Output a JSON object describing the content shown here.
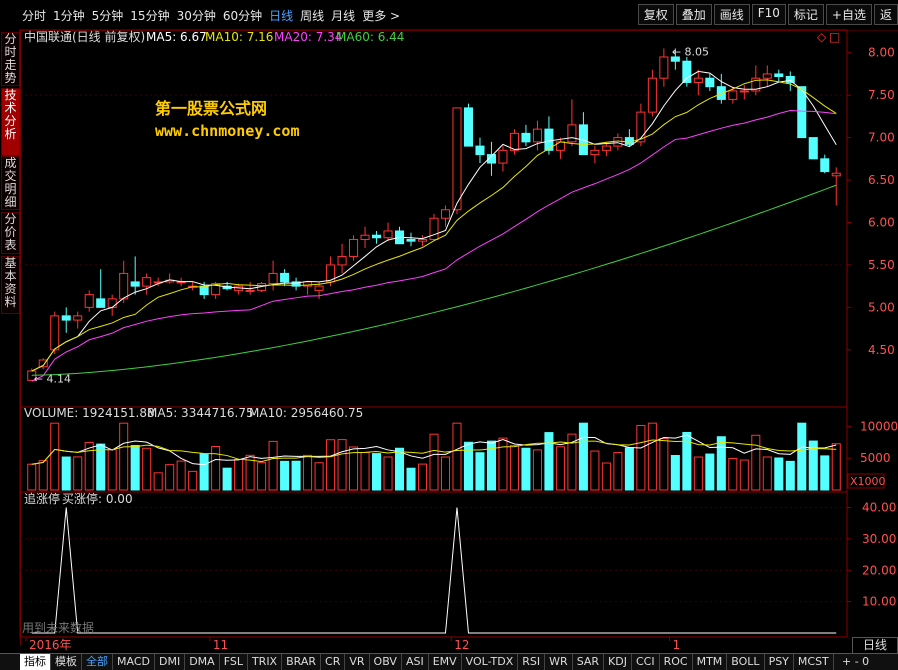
{
  "periods": [
    "分时",
    "1分钟",
    "5分钟",
    "15分钟",
    "30分钟",
    "60分钟",
    "日线",
    "周线",
    "月线",
    "更多 >"
  ],
  "active_period": "日线",
  "tools": [
    "复权",
    "叠加",
    "画线",
    "F10",
    "标记",
    "+自选",
    "返"
  ],
  "left_tabs": [
    "分时走势",
    "技术分析",
    "成交明细",
    "分价表",
    "基本资料"
  ],
  "active_left_tab": "技术分析",
  "main": {
    "stock": "中国联通(日线 前复权)",
    "ma5": "MA5: 6.67",
    "ma10": "MA10: 7.16",
    "ma20": "MA20: 7.34",
    "ma60": "MA60: 6.44",
    "yticks": [
      "8.00",
      "7.50",
      "7.00",
      "6.50",
      "6.00",
      "5.50",
      "5.00",
      "4.50"
    ],
    "high_label": "8.05",
    "low_label": "4.14",
    "colors": {
      "up": "#ff3333",
      "down": "#54ffff",
      "ma5": "#ffffff",
      "ma10": "#e6e600",
      "ma20": "#ff40ff",
      "ma60": "#40d040"
    }
  },
  "watermark": {
    "line1": "第一股票公式网",
    "line2": "www.chnmoney.com"
  },
  "volume": {
    "label": "VOLUME: 1924151.88",
    "ma5": "MA5: 3344716.75",
    "ma10": "MA10: 2956460.75",
    "yticks": [
      "10000",
      "5000"
    ],
    "unit": "X1000"
  },
  "indicator": {
    "title": "追涨停",
    "sub": "买涨停: 0.00",
    "yticks": [
      "40.00",
      "30.00",
      "20.00",
      "10.00"
    ],
    "note": "用到未来数据"
  },
  "xaxis": {
    "labels": [
      "2016年",
      "11",
      "12",
      "1"
    ]
  },
  "period_button": "日线",
  "bottom_tabs": [
    "指标",
    "模板",
    "全部",
    "MACD",
    "DMI",
    "DMA",
    "FSL",
    "TRIX",
    "BRAR",
    "CR",
    "VR",
    "OBV",
    "ASI",
    "EMV",
    "VOL-TDX",
    "RSI",
    "WR",
    "SAR",
    "KDJ",
    "CCI",
    "ROC",
    "MTM",
    "BOLL",
    "PSY",
    "MCST"
  ],
  "zoom": "+ - 0",
  "chart_data": {
    "type": "candlestick",
    "series": [
      {
        "name": "K",
        "ohlc": [
          [
            4.14,
            4.28,
            4.14,
            4.25
          ],
          [
            4.3,
            4.4,
            4.27,
            4.38
          ],
          [
            4.5,
            4.95,
            4.45,
            4.9
          ],
          [
            4.9,
            5.0,
            4.7,
            4.85
          ],
          [
            4.85,
            4.95,
            4.75,
            4.9
          ],
          [
            5.0,
            5.2,
            4.95,
            5.15
          ],
          [
            5.1,
            5.45,
            5.0,
            5.0
          ],
          [
            5.0,
            5.15,
            4.9,
            5.1
          ],
          [
            5.1,
            5.55,
            5.05,
            5.4
          ],
          [
            5.3,
            5.6,
            5.15,
            5.25
          ],
          [
            5.25,
            5.4,
            5.15,
            5.35
          ],
          [
            5.3,
            5.35,
            5.25,
            5.3
          ],
          [
            5.3,
            5.4,
            5.28,
            5.32
          ],
          [
            5.3,
            5.35,
            5.25,
            5.3
          ],
          [
            5.25,
            5.3,
            5.2,
            5.25
          ],
          [
            5.25,
            5.3,
            5.1,
            5.15
          ],
          [
            5.15,
            5.3,
            5.1,
            5.28
          ],
          [
            5.25,
            5.3,
            5.2,
            5.22
          ],
          [
            5.2,
            5.28,
            5.15,
            5.25
          ],
          [
            5.2,
            5.3,
            5.15,
            5.2
          ],
          [
            5.2,
            5.3,
            5.18,
            5.28
          ],
          [
            5.28,
            5.55,
            5.2,
            5.4
          ],
          [
            5.4,
            5.45,
            5.25,
            5.3
          ],
          [
            5.3,
            5.35,
            5.2,
            5.25
          ],
          [
            5.25,
            5.3,
            5.15,
            5.3
          ],
          [
            5.2,
            5.3,
            5.1,
            5.25
          ],
          [
            5.3,
            5.6,
            5.25,
            5.5
          ],
          [
            5.5,
            5.75,
            5.4,
            5.6
          ],
          [
            5.6,
            5.85,
            5.55,
            5.8
          ],
          [
            5.8,
            5.95,
            5.7,
            5.85
          ],
          [
            5.85,
            5.9,
            5.75,
            5.82
          ],
          [
            5.82,
            6.0,
            5.78,
            5.9
          ],
          [
            5.9,
            5.95,
            5.75,
            5.75
          ],
          [
            5.8,
            5.88,
            5.72,
            5.78
          ],
          [
            5.78,
            5.85,
            5.72,
            5.8
          ],
          [
            5.8,
            6.1,
            5.78,
            6.05
          ],
          [
            6.05,
            6.2,
            5.95,
            6.15
          ],
          [
            6.15,
            7.35,
            6.1,
            7.35
          ],
          [
            7.35,
            7.4,
            6.95,
            6.9
          ],
          [
            6.9,
            7.0,
            6.7,
            6.8
          ],
          [
            6.8,
            6.95,
            6.55,
            6.7
          ],
          [
            6.7,
            6.9,
            6.6,
            6.85
          ],
          [
            6.85,
            7.1,
            6.8,
            7.05
          ],
          [
            7.05,
            7.15,
            6.9,
            6.95
          ],
          [
            6.95,
            7.2,
            6.85,
            7.1
          ],
          [
            7.1,
            7.25,
            6.8,
            6.85
          ],
          [
            6.85,
            7.0,
            6.75,
            6.95
          ],
          [
            6.95,
            7.45,
            6.9,
            7.15
          ],
          [
            7.15,
            7.3,
            6.8,
            6.8
          ],
          [
            6.8,
            6.9,
            6.7,
            6.85
          ],
          [
            6.85,
            6.95,
            6.78,
            6.9
          ],
          [
            6.9,
            7.05,
            6.85,
            7.0
          ],
          [
            7.0,
            7.1,
            6.9,
            6.92
          ],
          [
            6.95,
            7.4,
            6.9,
            7.3
          ],
          [
            7.3,
            7.8,
            7.25,
            7.7
          ],
          [
            7.7,
            8.05,
            7.6,
            7.95
          ],
          [
            7.95,
            8.05,
            7.8,
            7.9
          ],
          [
            7.9,
            7.95,
            7.6,
            7.65
          ],
          [
            7.65,
            7.8,
            7.5,
            7.7
          ],
          [
            7.7,
            7.75,
            7.55,
            7.6
          ],
          [
            7.6,
            7.75,
            7.4,
            7.45
          ],
          [
            7.45,
            7.6,
            7.4,
            7.55
          ],
          [
            7.55,
            7.62,
            7.45,
            7.55
          ],
          [
            7.55,
            7.85,
            7.5,
            7.7
          ],
          [
            7.7,
            7.85,
            7.6,
            7.75
          ],
          [
            7.75,
            7.8,
            7.65,
            7.72
          ],
          [
            7.72,
            7.78,
            7.55,
            7.65
          ],
          [
            7.6,
            7.55,
            7.0,
            7.0
          ],
          [
            7.0,
            6.95,
            6.75,
            6.75
          ],
          [
            6.75,
            6.8,
            6.58,
            6.6
          ],
          [
            6.55,
            6.65,
            6.2,
            6.58
          ]
        ]
      }
    ],
    "ylim": [
      4.14,
      8.2
    ]
  }
}
